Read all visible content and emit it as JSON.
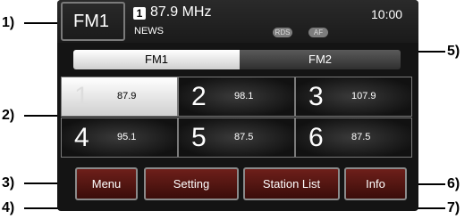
{
  "callouts": [
    "1)",
    "2)",
    "3)",
    "4)",
    "5)",
    "6)",
    "7)"
  ],
  "header": {
    "band": "FM1",
    "preset_number": "1",
    "frequency": "87.9 MHz",
    "time": "10:00",
    "ps_name": "NEWS",
    "rds_badge": "RDS",
    "af_badge": "AF"
  },
  "tabs": [
    "FM1",
    "FM2"
  ],
  "presets": [
    {
      "number": "1",
      "frequency": "87.9"
    },
    {
      "number": "2",
      "frequency": "98.1"
    },
    {
      "number": "3",
      "frequency": "107.9"
    },
    {
      "number": "4",
      "frequency": "95.1"
    },
    {
      "number": "5",
      "frequency": "87.5"
    },
    {
      "number": "6",
      "frequency": "87.5"
    }
  ],
  "softkeys": [
    "Menu",
    "Setting",
    "Station List",
    "Info"
  ]
}
